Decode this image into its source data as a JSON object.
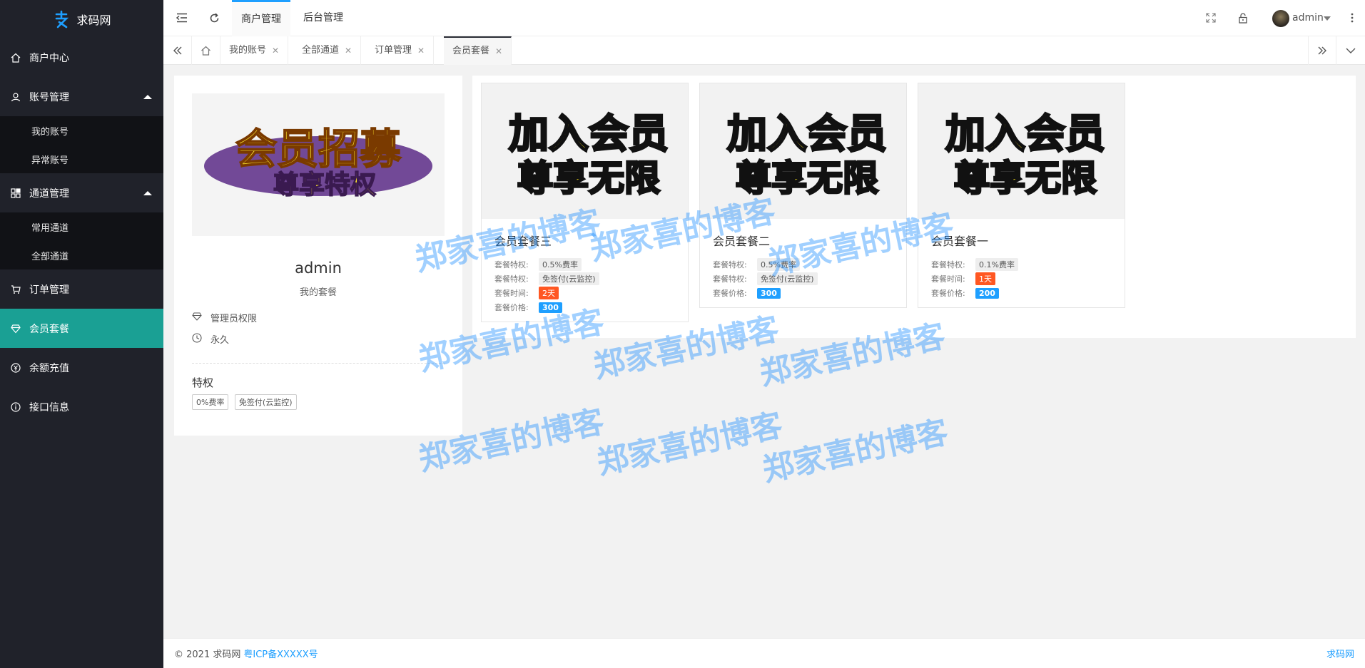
{
  "app": {
    "name": "求码网"
  },
  "sidebar": {
    "items": [
      {
        "label": "商户中心"
      },
      {
        "label": "账号管理",
        "children": [
          "我的账号",
          "异常账号"
        ]
      },
      {
        "label": "通道管理",
        "children": [
          "常用通道",
          "全部通道"
        ]
      },
      {
        "label": "订单管理"
      },
      {
        "label": "会员套餐"
      },
      {
        "label": "余额充值"
      },
      {
        "label": "接口信息"
      }
    ]
  },
  "header": {
    "tabs": [
      "商户管理",
      "后台管理"
    ],
    "user": "admin"
  },
  "page_tabs": [
    "我的账号",
    "全部通道",
    "订单管理",
    "会员套餐"
  ],
  "profile": {
    "banner_line1": "会员招募",
    "banner_line2": "尊享特权",
    "name": "admin",
    "subtitle": "我的套餐",
    "permission": "管理员权限",
    "duration": "永久",
    "privileges_title": "特权",
    "tags": [
      "0%费率",
      "免签付(云监控)"
    ]
  },
  "plans": [
    {
      "title": "会员套餐三",
      "rows": [
        {
          "label": "套餐特权:",
          "value": "0.5%费率",
          "style": "plain"
        },
        {
          "label": "套餐特权:",
          "value": "免签付(云监控)",
          "style": "plain"
        },
        {
          "label": "套餐时间:",
          "value": "2天",
          "style": "red"
        },
        {
          "label": "套餐价格:",
          "value": "300",
          "style": "blue"
        }
      ]
    },
    {
      "title": "会员套餐二",
      "rows": [
        {
          "label": "套餐特权:",
          "value": "0.5%费率",
          "style": "plain"
        },
        {
          "label": "套餐特权:",
          "value": "免签付(云监控)",
          "style": "plain"
        },
        {
          "label": "套餐价格:",
          "value": "300",
          "style": "blue"
        }
      ]
    },
    {
      "title": "会员套餐一",
      "rows": [
        {
          "label": "套餐特权:",
          "value": "0.1%费率",
          "style": "plain"
        },
        {
          "label": "套餐时间:",
          "value": "1天",
          "style": "red"
        },
        {
          "label": "套餐价格:",
          "value": "200",
          "style": "blue"
        }
      ]
    }
  ],
  "plan_banner": {
    "line1": "加入会员",
    "line2": "尊享无限"
  },
  "watermark": "郑家喜的博客",
  "footer": {
    "copyright": "© 2021 求码网",
    "icp": "粤ICP备XXXXX号",
    "right_link": "求码网"
  },
  "colors": {
    "sidebar": "#20222a",
    "active": "#1aa094",
    "accent": "#1e9fff",
    "red": "#ff5722"
  }
}
